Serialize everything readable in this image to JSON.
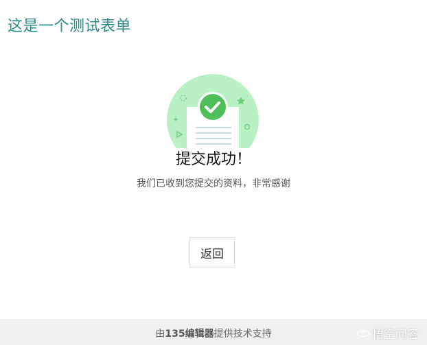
{
  "form_title": "这是一个测试表单",
  "success": {
    "title": "提交成功！",
    "message": "我们已收到您提交的资料，非常感谢"
  },
  "back_button_label": "返回",
  "footer": {
    "prefix": "由",
    "brand": "135编辑器",
    "suffix": "提供技术支持"
  },
  "watermark": "悟空问答",
  "colors": {
    "title": "#2a8c84",
    "illustration_circle": "#b9f1c4",
    "check_badge": "#4fbf5c",
    "footer_bg": "#f0f0f0"
  },
  "icons": {
    "illustration": "success-document-check",
    "watermark": "wukong-logo"
  }
}
